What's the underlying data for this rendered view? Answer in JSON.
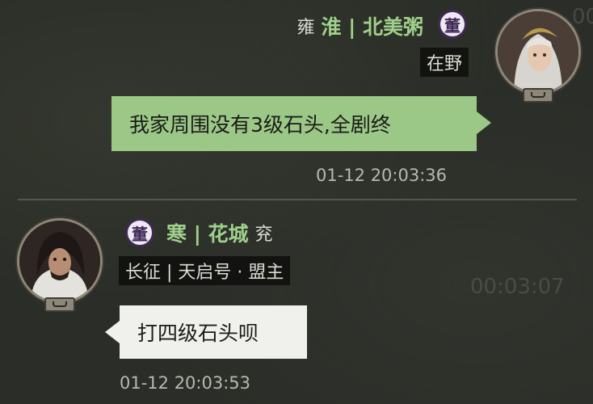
{
  "messages": [
    {
      "side": "right",
      "region": "雍",
      "name": "淮 | 北美粥",
      "badge": "董",
      "status_tag": "在野",
      "text": "我家周围没有3级石头,全剧终",
      "timestamp": "01-12 20:03:36",
      "bubble_color": "#9bc887"
    },
    {
      "side": "left",
      "badge": "董",
      "name": "寒 | 花城",
      "region": "兖",
      "status_tag": "长征 | 天启号 · 盟主",
      "text": "打四级石头呗",
      "timestamp": "01-12 20:03:53",
      "bubble_color": "#f0f0ec"
    }
  ],
  "background_overlay": {
    "timer_text": "00:03:07",
    "corner_text": "00"
  },
  "colors": {
    "name_green": "#9fd08c",
    "badge_purple": "#3c2b52",
    "background": "#2b2d28"
  }
}
